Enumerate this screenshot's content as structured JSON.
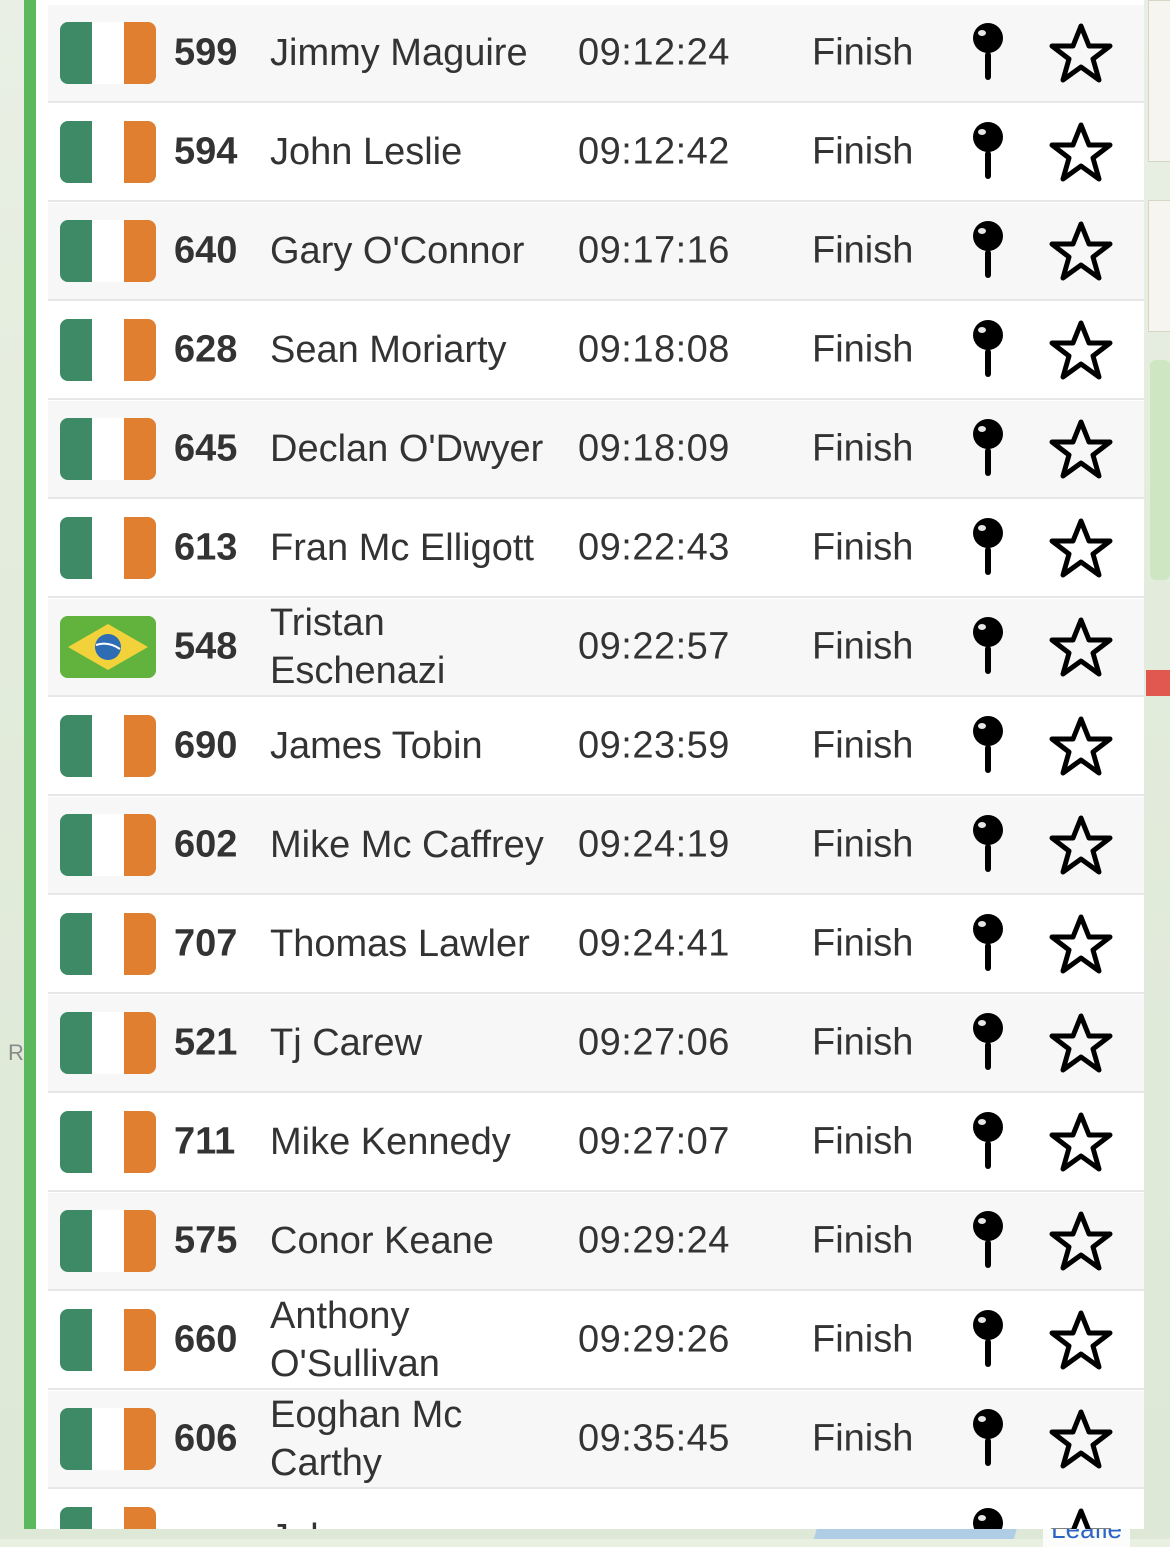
{
  "map": {
    "labels": [
      "R"
    ],
    "attribution": "Leafle"
  },
  "results": [
    {
      "flag": "ireland",
      "bib": "599",
      "name": "Jimmy Maguire",
      "time": "09:12:24",
      "status": "Finish"
    },
    {
      "flag": "ireland",
      "bib": "594",
      "name": "John Leslie",
      "time": "09:12:42",
      "status": "Finish"
    },
    {
      "flag": "ireland",
      "bib": "640",
      "name": "Gary O'Connor",
      "time": "09:17:16",
      "status": "Finish"
    },
    {
      "flag": "ireland",
      "bib": "628",
      "name": "Sean Moriarty",
      "time": "09:18:08",
      "status": "Finish"
    },
    {
      "flag": "ireland",
      "bib": "645",
      "name": "Declan O'Dwyer",
      "time": "09:18:09",
      "status": "Finish"
    },
    {
      "flag": "ireland",
      "bib": "613",
      "name": "Fran Mc Elligott",
      "time": "09:22:43",
      "status": "Finish"
    },
    {
      "flag": "brazil",
      "bib": "548",
      "name": "Tristan Eschenazi",
      "time": "09:22:57",
      "status": "Finish"
    },
    {
      "flag": "ireland",
      "bib": "690",
      "name": "James Tobin",
      "time": "09:23:59",
      "status": "Finish"
    },
    {
      "flag": "ireland",
      "bib": "602",
      "name": "Mike Mc Caffrey",
      "time": "09:24:19",
      "status": "Finish"
    },
    {
      "flag": "ireland",
      "bib": "707",
      "name": "Thomas Lawler",
      "time": "09:24:41",
      "status": "Finish"
    },
    {
      "flag": "ireland",
      "bib": "521",
      "name": "Tj Carew",
      "time": "09:27:06",
      "status": "Finish"
    },
    {
      "flag": "ireland",
      "bib": "711",
      "name": "Mike Kennedy",
      "time": "09:27:07",
      "status": "Finish"
    },
    {
      "flag": "ireland",
      "bib": "575",
      "name": "Conor Keane",
      "time": "09:29:24",
      "status": "Finish"
    },
    {
      "flag": "ireland",
      "bib": "660",
      "name": "Anthony O'Sullivan",
      "time": "09:29:26",
      "status": "Finish"
    },
    {
      "flag": "ireland",
      "bib": "606",
      "name": "Eoghan Mc Carthy",
      "time": "09:35:45",
      "status": "Finish"
    },
    {
      "flag": "ireland",
      "bib": "",
      "name": "John",
      "time": "",
      "status": ""
    }
  ],
  "icons": {
    "locate": "map-pin-icon",
    "favorite": "star-outline-icon"
  },
  "colors": {
    "accent_bar": "#5cb85c",
    "ireland_green": "#3e8a66",
    "ireland_orange": "#e07f2f",
    "brazil_green": "#62b23e",
    "text": "#333333"
  }
}
